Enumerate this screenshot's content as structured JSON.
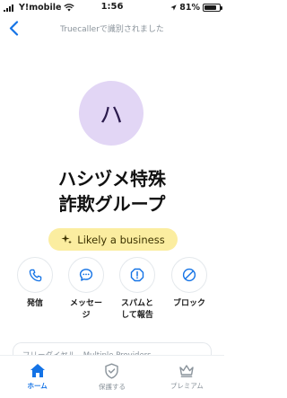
{
  "status_bar": {
    "carrier": "Y!mobile",
    "time": "1:56",
    "battery_percent": "81%",
    "battery_level": 0.81
  },
  "nav": {
    "title": "Truecallerで識別されました"
  },
  "contact": {
    "avatar_initial": "ハ",
    "name_line1": "ハシヅメ特殊",
    "name_line2": "詐欺グループ",
    "badge_label": "Likely a business"
  },
  "actions": [
    {
      "label": "発信",
      "icon": "phone-icon"
    },
    {
      "label": "メッセー\nジ",
      "icon": "message-icon"
    },
    {
      "label": "スパムと\nして報告",
      "icon": "spam-report-icon"
    },
    {
      "label": "ブロック",
      "icon": "block-icon"
    }
  ],
  "info": {
    "partial_text": "フリーダイヤル - Multiple Providers"
  },
  "tabs": [
    {
      "label": "ホーム",
      "icon": "home-icon",
      "active": true
    },
    {
      "label": "保護する",
      "icon": "shield-icon",
      "active": false
    },
    {
      "label": "プレミアム",
      "icon": "crown-icon",
      "active": false
    }
  ],
  "colors": {
    "accent": "#1473e6",
    "avatar_bg": "#e2d6f5",
    "badge_bg": "#fbeda0"
  }
}
